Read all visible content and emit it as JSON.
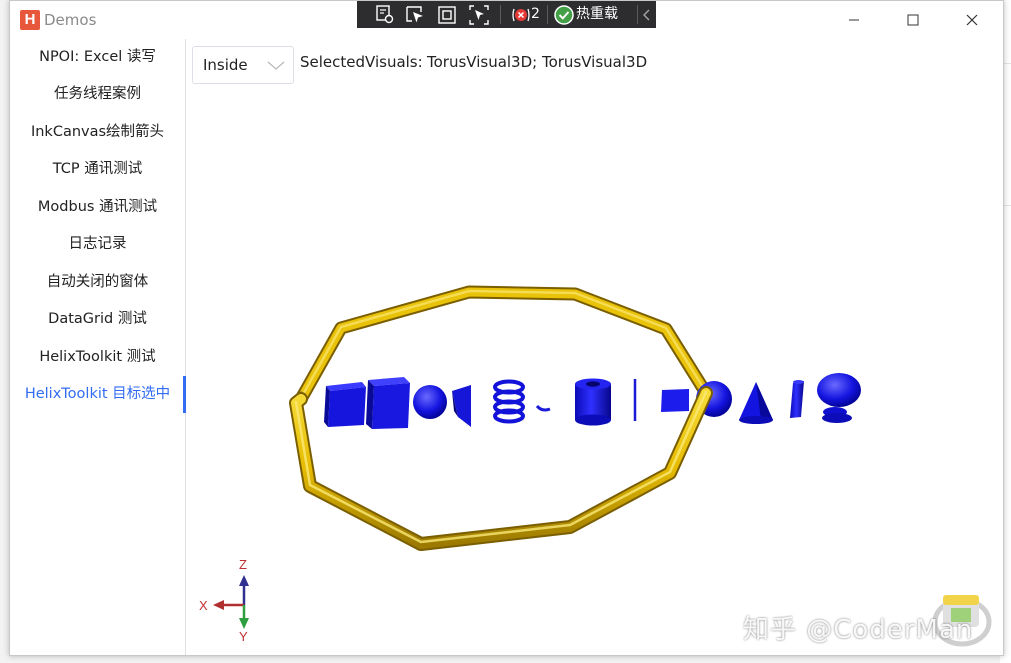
{
  "window": {
    "title": "Demos",
    "app_icon_letter": "H",
    "controls": {
      "minimize_icon": "minimize-icon",
      "maximize_icon": "maximize-icon",
      "close_icon": "close-icon"
    }
  },
  "devtools": {
    "tools": [
      "live-visual-tree-icon",
      "select-element-icon",
      "display-layout-adorners-icon",
      "track-focus-icon"
    ],
    "binding_failures_count": "2",
    "hot_reload_label": "热重载",
    "colors": {
      "background": "#2d2d30",
      "check": "#43a047",
      "error": "#e53935"
    }
  },
  "sidebar": {
    "items": [
      {
        "label": "NPOI: Excel 读写"
      },
      {
        "label": "任务线程案例"
      },
      {
        "label": "InkCanvas绘制箭头"
      },
      {
        "label": "TCP 通讯测试"
      },
      {
        "label": "Modbus 通讯测试"
      },
      {
        "label": "日志记录"
      },
      {
        "label": "自动关闭的窗体"
      },
      {
        "label": "DataGrid 测试"
      },
      {
        "label": "HelixToolkit 测试"
      },
      {
        "label": "HelixToolkit 目标选中"
      }
    ],
    "active_index": 9,
    "accent_color": "#326cf3"
  },
  "main": {
    "mode_combo": {
      "value": "Inside"
    },
    "selected_visuals": {
      "label": "SelectedVisuals:",
      "value": "TorusVisual3D; TorusVisual3D"
    },
    "viewport": {
      "axis_labels": {
        "x": "X",
        "y": "Y",
        "z": "Z"
      },
      "colors": {
        "torus": "#f0c808",
        "shapes": "#1010e8",
        "x_axis": "#b03030",
        "y_axis": "#2e9e3e",
        "z_axis": "#303090"
      }
    }
  },
  "watermark": {
    "text": "知乎 @CoderMan"
  }
}
